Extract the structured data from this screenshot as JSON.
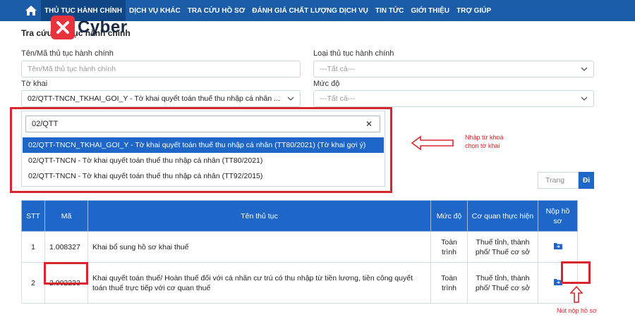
{
  "nav": {
    "items": [
      "THỦ TỤC HÀNH CHÍNH",
      "DỊCH VỤ KHÁC",
      "TRA CỨU HỒ SƠ",
      "ĐÁNH GIÁ CHẤT LƯỢNG DỊCH VỤ",
      "TIN TỨC",
      "GIỚI THIỆU",
      "TRỢ GIÚP"
    ]
  },
  "logo": {
    "text": "Cyber"
  },
  "page": {
    "title": "Tra cứu thủ tục hành chính"
  },
  "form": {
    "name_label": "Tên/Mã thủ tục hành chính",
    "name_placeholder": "Tên/Mã thủ tục hành chính",
    "type_label": "Loại thủ tục hành chính",
    "type_value": "---Tất cả---",
    "form_label": "Tờ khai",
    "form_value": "02/QTT-TNCN_TKHAI_GOI_Y - Tờ khai quyết toán thuế thu nhập cá nhân ...",
    "level_label": "Mức độ",
    "level_value": "---Tất cả---"
  },
  "dropdown": {
    "search_value": "02/QTT",
    "options": [
      "02/QTT-TNCN_TKHAI_GOI_Y - Tờ khai quyết toán thuế thu nhập cá nhân (TT80/2021) (Tờ khai gợi ý)",
      "02/QTT-TNCN - Tờ khai quyết toán thuế thu nhập cá nhân (TT80/2021)",
      "02/QTT-TNCN - Tờ khai quyết toán thuế thu nhập cá nhân (TT92/2015)"
    ]
  },
  "annotations": {
    "keyword_line1": "Nhập từ khoá",
    "keyword_line2": "chọn tờ khai",
    "submit_button": "Nút nộp hồ sơ"
  },
  "pagination": {
    "placeholder": "Trang",
    "go_label": "Đi"
  },
  "table": {
    "headers": [
      "STT",
      "Mã",
      "Tên thủ tục",
      "Mức độ",
      "Cơ quan thực hiện",
      "Nộp hồ sơ"
    ],
    "rows": [
      {
        "stt": "1",
        "code": "1.008327",
        "name": "Khai bổ sung hồ sơ khai thuế",
        "level": "Toàn trình",
        "agency": "Thuế tỉnh, thành phố/ Thuế cơ sở"
      },
      {
        "stt": "2",
        "code": "2.002233",
        "name": "Khai quyết toán thuế/ Hoàn thuế đối với cá nhân cư trú có thu nhập từ tiền lương, tiền công quyết toán thuế trực tiếp với cơ quan thuế",
        "level": "Toàn trình",
        "agency": "Thuế tỉnh, thành phố/ Thuế cơ sở"
      }
    ]
  },
  "colors": {
    "nav_bg": "#1a5ca8",
    "accent": "#1e66c8",
    "highlight": "#d8262e",
    "link": "#2f6db5"
  }
}
